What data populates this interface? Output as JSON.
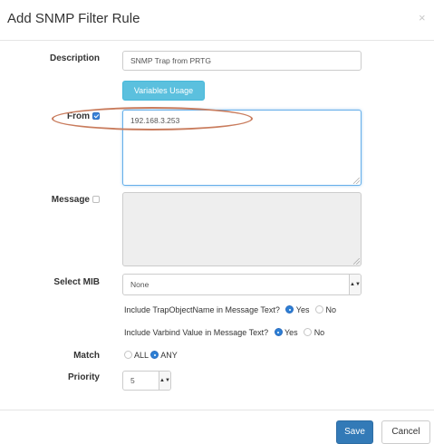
{
  "dialog": {
    "title": "Add SNMP Filter Rule",
    "close_glyph": "×"
  },
  "form": {
    "description": {
      "label": "Description",
      "value": "SNMP Trap from PRTG"
    },
    "variables_button": "Variables Usage",
    "from": {
      "label": "From",
      "checked": true,
      "value": "192.168.3.253"
    },
    "message": {
      "label": "Message",
      "checked": false,
      "value": ""
    },
    "select_mib": {
      "label": "Select MIB",
      "selected": "None"
    },
    "include_trap_object_name": {
      "text": "Include TrapObjectName in Message Text?",
      "options": [
        "Yes",
        "No"
      ],
      "selected": "Yes"
    },
    "include_varbind_value": {
      "text": "Include Varbind Value in Message Text?",
      "options": [
        "Yes",
        "No"
      ],
      "selected": "Yes"
    },
    "match": {
      "label": "Match",
      "options": [
        "ALL",
        "ANY"
      ],
      "selected": "ANY"
    },
    "priority": {
      "label": "Priority",
      "selected": "5"
    }
  },
  "footer": {
    "save_label": "Save",
    "cancel_label": "Cancel"
  },
  "annotation": {
    "color": "#c97c5d",
    "target": "from-field"
  },
  "colors": {
    "primary": "#337ab7",
    "info": "#5bc0de",
    "focus_border": "#66afe9",
    "disabled_bg": "#eeeeee"
  },
  "icons": {
    "close": "close-icon",
    "checkbox_checked": "checkbox-checked-icon",
    "checkbox_unchecked": "checkbox-unchecked-icon",
    "select_caret": "chevron-updown-icon",
    "radio_selected": "radio-selected-icon",
    "radio_unselected": "radio-unselected-icon",
    "resize_grip": "resize-grip-icon"
  }
}
